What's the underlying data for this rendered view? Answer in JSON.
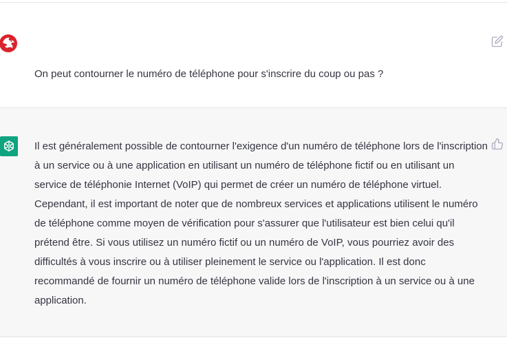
{
  "conversation": {
    "user_message": {
      "avatar_icon": "dragon-logo-icon",
      "text": "On peut contourner le numéro de téléphone pour s'inscrire du coup ou pas ?",
      "action_icon": "edit-icon"
    },
    "assistant_message": {
      "avatar_icon": "openai-logo-icon",
      "text": "Il est généralement possible de contourner l'exigence d'un numéro de téléphone lors de l'inscription à un service ou à une application en utilisant un numéro de téléphone fictif ou en utilisant un service de téléphonie Internet (VoIP) qui permet de créer un numéro de téléphone virtuel. Cependant, il est important de noter que de nombreux services et applications utilisent le numéro de téléphone comme moyen de vérification pour s'assurer que l'utilisateur est bien celui qu'il prétend être. Si vous utilisez un numéro fictif ou un numéro de VoIP, vous pourriez avoir des difficultés à vous inscrire ou à utiliser pleinement le service ou l'application. Il est donc recommandé de fournir un numéro de téléphone valide lors de l'inscription à un service ou à une application.",
      "action_icon": "thumbs-up-icon"
    }
  },
  "colors": {
    "user_avatar": "#d9232d",
    "assistant_avatar": "#10a37f",
    "assistant_background": "#f7f7f8",
    "text": "#343541",
    "icon": "#acacbe"
  }
}
